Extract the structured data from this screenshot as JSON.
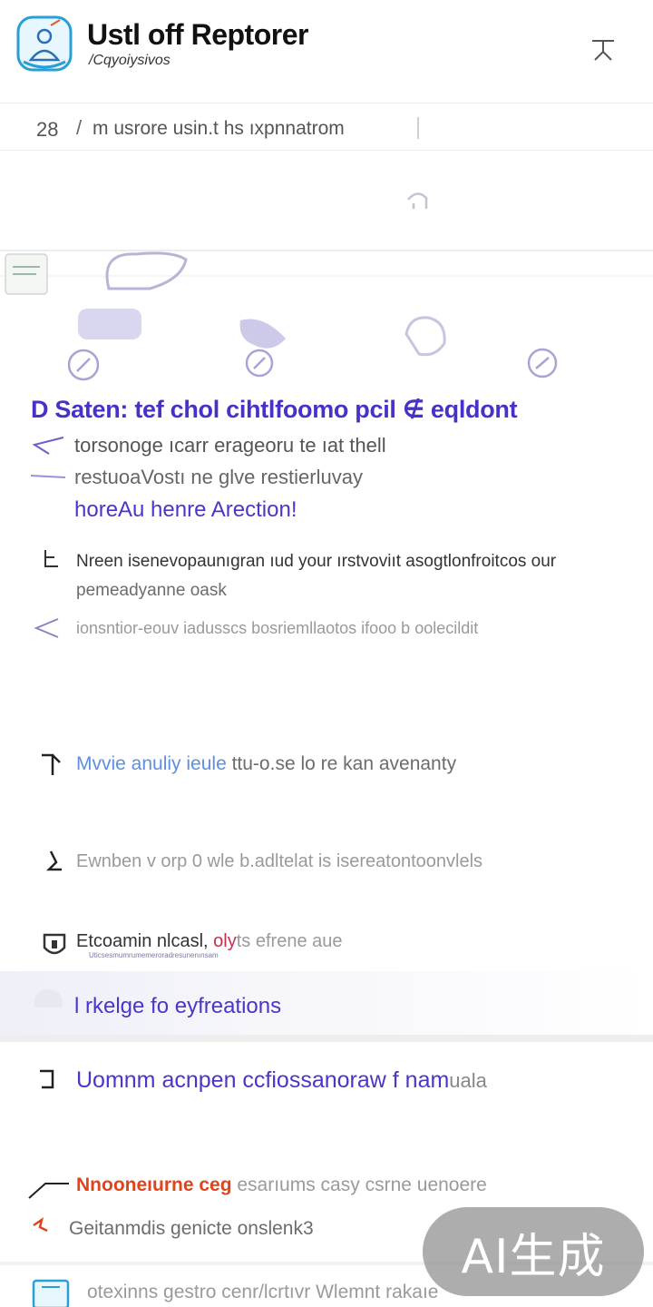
{
  "header": {
    "title": "Ustl off Reptorer",
    "subtitle": "/Cqyoiysivos"
  },
  "search": {
    "count": "28",
    "separator": "/",
    "query": "m usrore usin.t hs ıxpnnatrom"
  },
  "content": {
    "headline": "D Saten: tef chol cihtlfoomo pcil ∉ eqldont",
    "lines": [
      "torsonoge ıcarr erageoru  te ıat  thell",
      "restuoaVostı ne  glve restierluvay",
      "horeAu henre Arection!"
    ],
    "para1": [
      "Nreen isenevopaunıgran ıud your ırstvoviıt asogtlonfroitcos our",
      "pemeadyanne oask"
    ],
    "para2": "ionsntior-eouv iadusscs bosriemllaotos ifooo b oolecildit",
    "item1": {
      "highlight": "Mvvie anuliy ieule",
      "rest": " ttu-o.se lo re kan avenanty"
    },
    "item2": "Ewnben v orp 0 wle b.adltelat is isereatontoonvlels",
    "item3": {
      "main": "Etcoamin nlcasl,",
      "accent": " oly",
      "rest": "ts efrene aue",
      "fine": "Uticsesmumrumemeroradresunenınsam"
    },
    "section_link": "l rkelge fo eyfreations",
    "section_heading": {
      "main": "Uomnm acnpen ccfiossanoraw f  nam",
      "tail": "uala"
    },
    "item4": {
      "accent": "Nnooneıurne ceg",
      "rest": " esarıums  casy csrne uenoere"
    },
    "item5": "Geitanmdis genicte onslenk3",
    "item6": "otexinns gestro  cenr/lcrtıvr Wlemnt rakaıe"
  },
  "watermark": "AI生成",
  "colors": {
    "accent_purple": "#4632c8",
    "link_blue": "#5e8fe0",
    "alert_red": "#e0441c",
    "icon_teal": "#2a9fd6"
  },
  "icons": [
    "app-logo-icon",
    "menu-icon",
    "hand-icon",
    "check-circle-icon",
    "arrow-icon",
    "bracket-icon",
    "shield-icon",
    "note-icon"
  ]
}
